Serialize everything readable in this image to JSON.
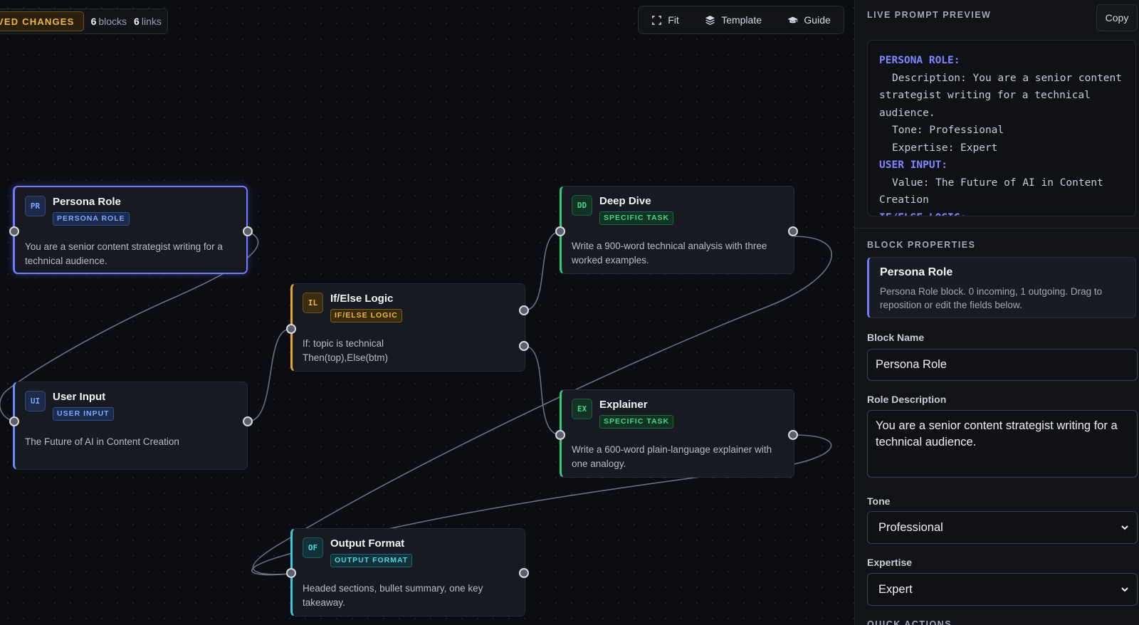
{
  "status": {
    "unsaved_label": "VED CHANGES",
    "blocks_count": "6",
    "blocks_label": "blocks",
    "links_count": "6",
    "links_label": "links"
  },
  "toolbar": {
    "fit_label": "Fit",
    "template_label": "Template",
    "guide_label": "Guide"
  },
  "nodes": {
    "persona": {
      "abbr": "PR",
      "title": "Persona Role",
      "tag": "PERSONA ROLE",
      "desc": "You are a senior content strategist writing for a technical audience."
    },
    "user": {
      "abbr": "UI",
      "title": "User Input",
      "tag": "USER INPUT",
      "desc": "The Future of AI in Content Creation"
    },
    "ifelse": {
      "abbr": "IL",
      "title": "If/Else Logic",
      "tag": "IF/ELSE LOGIC",
      "desc_line1": "If: topic is technical",
      "desc_line2": "Then(top),Else(btm)"
    },
    "deepdive": {
      "abbr": "DD",
      "title": "Deep Dive",
      "tag": "SPECIFIC TASK",
      "desc": "Write a 900-word technical analysis with three worked examples."
    },
    "explainer": {
      "abbr": "EX",
      "title": "Explainer",
      "tag": "SPECIFIC TASK",
      "desc": "Write a 600-word plain-language explainer with one analogy."
    },
    "output": {
      "abbr": "OF",
      "title": "Output Format",
      "tag": "OUTPUT FORMAT",
      "desc": "Headed sections, bullet summary, one key takeaway."
    }
  },
  "panel": {
    "preview_title": "LIVE PROMPT PREVIEW",
    "copy_label": "Copy",
    "preview": {
      "persona_key": "PERSONA ROLE:",
      "persona_desc": "Description: You are a senior content strategist writing for a technical audience.",
      "persona_tone": "Tone: Professional",
      "persona_expertise": "Expertise: Expert",
      "user_key": "USER INPUT:",
      "user_value": "Value: The Future of AI in Content Creation",
      "ifelse_key": "IF/ELSE LOGIC:"
    },
    "properties_title": "BLOCK PROPERTIES",
    "info_title": "Persona Role",
    "info_text": "Persona Role block. 0 incoming, 1 outgoing. Drag to reposition or edit the fields below.",
    "block_name_label": "Block Name",
    "block_name_value": "Persona Role",
    "role_desc_label": "Role Description",
    "role_desc_value": "You are a senior content strategist writing for a technical audience.",
    "tone_label": "Tone",
    "tone_value": "Professional",
    "expertise_label": "Expertise",
    "expertise_value": "Expert",
    "quick_actions_title": "QUICK ACTIONS"
  },
  "colors": {
    "accent": "#6c7dff",
    "amber": "#f0b93b",
    "green": "#46d68c",
    "teal": "#52d5e2",
    "blue": "#7fa7ff"
  }
}
